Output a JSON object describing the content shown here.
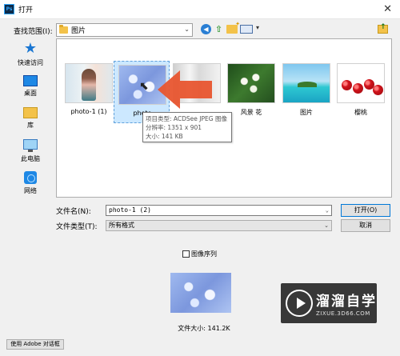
{
  "window": {
    "title": "打开",
    "app_icon": "Ps"
  },
  "toolbar": {
    "lookin_label": "查找范围(I):",
    "lookin_value": "图片",
    "icons": [
      "back-icon",
      "up-folder-icon",
      "new-folder-icon",
      "view-menu-icon"
    ]
  },
  "places": [
    {
      "label": "快速访问",
      "icon": "quick-access-star-icon"
    },
    {
      "label": "桌面",
      "icon": "desktop-icon"
    },
    {
      "label": "库",
      "icon": "library-icon"
    },
    {
      "label": "此电脑",
      "icon": "this-pc-icon"
    },
    {
      "label": "网络",
      "icon": "network-icon"
    }
  ],
  "files": [
    {
      "label": "photo-1 (1)",
      "selected": false
    },
    {
      "label": "photo",
      "selected": true
    },
    {
      "label": "",
      "selected": false
    },
    {
      "label": "风景 花",
      "selected": false
    },
    {
      "label": "图片",
      "selected": false
    },
    {
      "label": "樱桃",
      "selected": false
    }
  ],
  "tooltip": {
    "type": "项目类型: ACDSee JPEG 图像",
    "dimensions": "分辨率: 1351 x 901",
    "size": "大小: 141 KB"
  },
  "form": {
    "filename_label": "文件名(N):",
    "filename_value": "photo-1 (2)",
    "filetype_label": "文件类型(T):",
    "filetype_value": "所有格式",
    "open_button": "打开(O)",
    "cancel_button": "取消"
  },
  "sequence": {
    "label": "图像序列",
    "checked": false
  },
  "preview": {
    "size_text": "文件大小: 141.2K"
  },
  "footer": {
    "adobe_dialog_button": "使用 Adobe 对话框"
  },
  "watermark": {
    "title": "溜溜自学",
    "url": "ZIXUE.3D66.COM"
  },
  "colors": {
    "selection": "#cce8ff",
    "arrow": "#e8552f",
    "accent": "#0078d7"
  }
}
